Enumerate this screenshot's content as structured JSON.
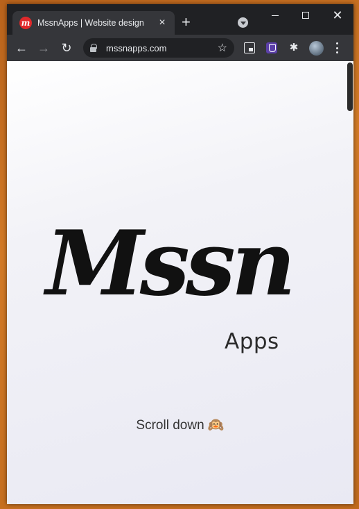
{
  "tab": {
    "title": "MssnApps | Website design",
    "favicon_letter": "m",
    "close_glyph": "×"
  },
  "new_tab_glyph": "+",
  "window_controls": {
    "close_glyph": "✕"
  },
  "toolbar": {
    "back_glyph": "←",
    "forward_glyph": "→",
    "reload_glyph": "↻",
    "url": "mssnapps.com",
    "star_glyph": "☆",
    "puzzle_glyph": "✱"
  },
  "page": {
    "logo": "Mssn",
    "logo_sub": "Apps",
    "scroll_hint": "Scroll down 🙉"
  },
  "colors": {
    "favicon": "#e0292b",
    "extension": "#5b3fa8",
    "chrome_dark": "#202124",
    "chrome_toolbar": "#35363a"
  },
  "icons": [
    "favicon-icon",
    "tab-close-icon",
    "new-tab-icon",
    "tab-search-icon",
    "minimize-icon",
    "maximize-icon",
    "close-icon",
    "back-icon",
    "forward-icon",
    "reload-icon",
    "lock-icon",
    "star-icon",
    "picture-in-picture-icon",
    "extension-icon",
    "puzzle-icon",
    "profile-avatar",
    "menu-icon"
  ]
}
